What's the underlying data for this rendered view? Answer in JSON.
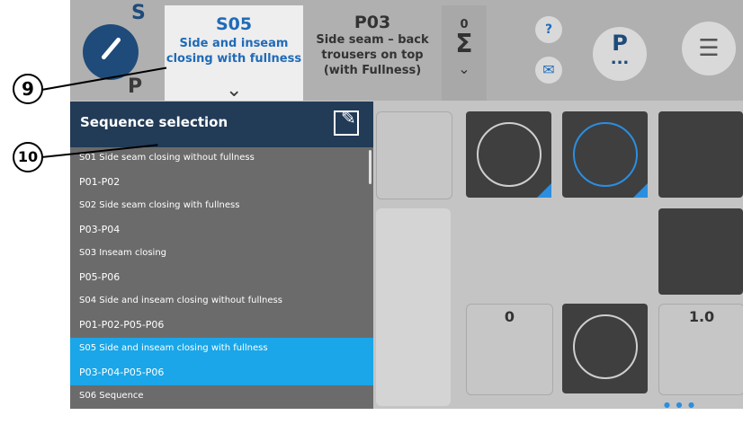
{
  "header": {
    "mode_s": "S",
    "mode_p": "P",
    "active_tab": {
      "code": "S05",
      "description": "Side and inseam closing with fullness"
    },
    "inactive_tab": {
      "code": "P03",
      "description": "Side seam – back trousers on top (with Fullness)"
    },
    "counter": {
      "value": "0",
      "symbol": "Σ"
    },
    "help_label": "?",
    "program_label": "P",
    "program_dots": "..."
  },
  "callouts": {
    "top": "9",
    "bottom": "10"
  },
  "panel": {
    "title": "Sequence selection",
    "items": [
      {
        "sequence": "S01 Side seam closing without fullness",
        "programs": "P01-P02"
      },
      {
        "sequence": "S02 Side seam closing with fullness",
        "programs": "P03-P04"
      },
      {
        "sequence": "S03 Inseam closing",
        "programs": "P05-P06"
      },
      {
        "sequence": "S04 Side and inseam closing without fullness",
        "programs": "P01-P02-P05-P06"
      },
      {
        "sequence": "S05 Side and inseam closing with fullness",
        "programs": "P03-P04-P05-P06"
      },
      {
        "sequence": "S06 Sequence",
        "programs": ""
      }
    ],
    "selected_index": 4
  },
  "tiles": {
    "counter_value": "0",
    "stitch_length": "1.0"
  },
  "colors": {
    "accent": "#1aa6e8",
    "header_bg": "#223b57",
    "brand_blue": "#1e4b7a",
    "tab_text": "#1f6bb8"
  }
}
